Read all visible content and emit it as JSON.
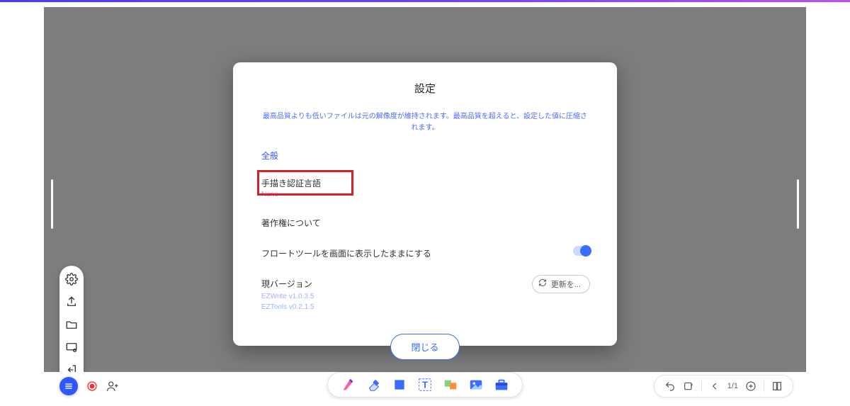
{
  "modal": {
    "title": "設定",
    "description": "最高品質よりも低いファイルは元の解像度が維持されます。最高品質を超えると、設定した値に圧縮されます。",
    "section_general": "全般",
    "handwriting_label": "手描き認証言語",
    "handwriting_value": "None",
    "copyright_label": "著作権について",
    "float_tool_label": "フロートツールを画面に表示したままにする",
    "version_label": "現バージョン",
    "version_line1": "EZWrite v1.0.3.5",
    "version_line2": "EZTools v0.2.1.5",
    "update_btn": "更新を...",
    "close_btn": "閉じる"
  },
  "pager": {
    "page": "1/1"
  }
}
